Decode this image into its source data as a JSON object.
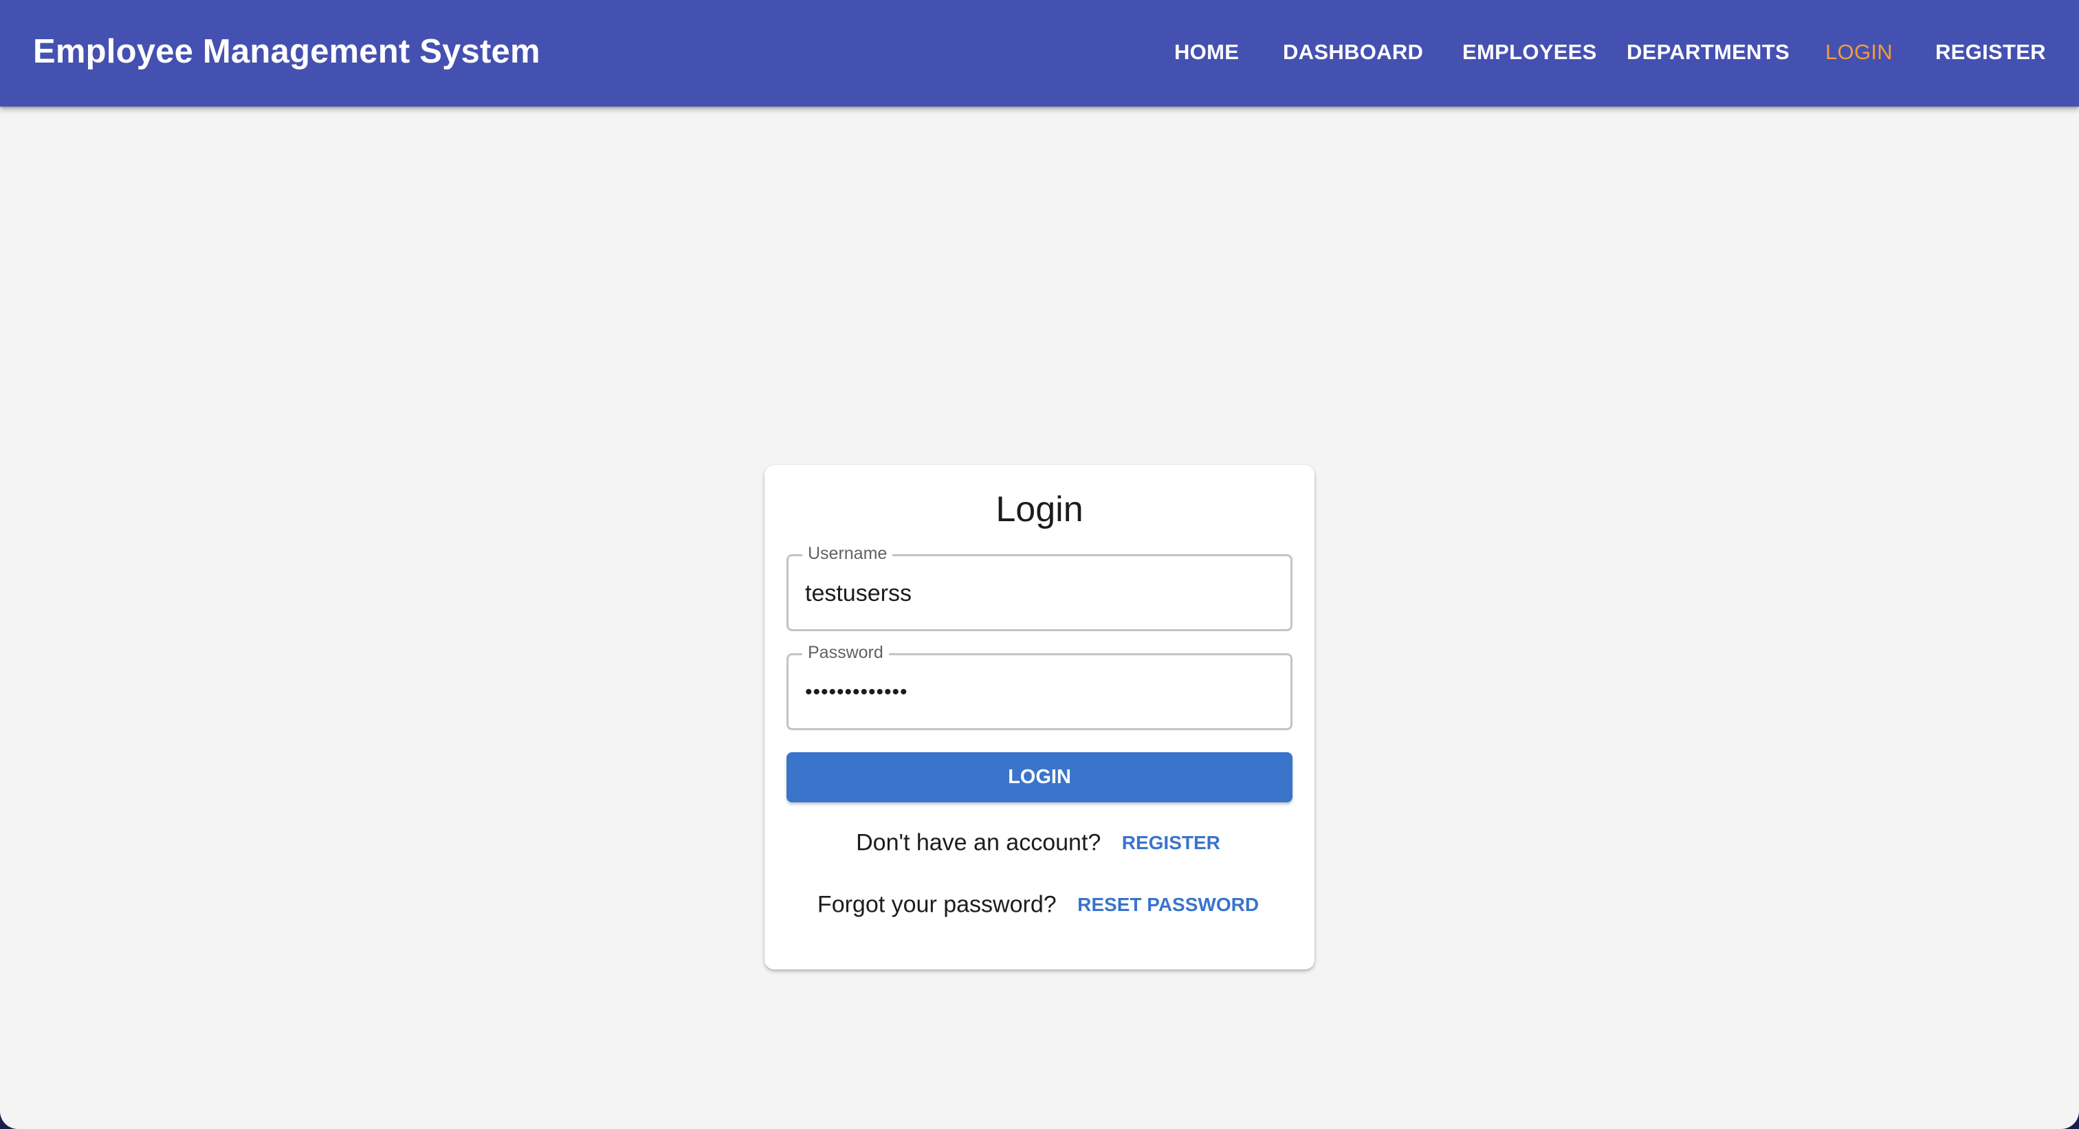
{
  "app": {
    "title": "Employee Management System"
  },
  "nav": {
    "items": [
      {
        "label": "HOME",
        "active": false
      },
      {
        "label": "DASHBOARD",
        "active": false
      },
      {
        "label": "EMPLOYEES",
        "active": false
      },
      {
        "label": "DEPARTMENTS",
        "active": false
      },
      {
        "label": "LOGIN",
        "active": true
      },
      {
        "label": "REGISTER",
        "active": false
      }
    ]
  },
  "login_form": {
    "title": "Login",
    "username": {
      "label": "Username",
      "value": "testuserss"
    },
    "password": {
      "label": "Password",
      "value": "•••••••••••••"
    },
    "submit_label": "LOGIN",
    "register_prompt": "Don't have an account?",
    "register_link": "REGISTER",
    "reset_prompt": "Forgot your password?",
    "reset_link": "RESET PASSWORD"
  },
  "colors": {
    "appbar": "#4551b1",
    "nav_active": "#f29c38",
    "primary": "#3a74cb",
    "background": "#f4f4f4"
  }
}
